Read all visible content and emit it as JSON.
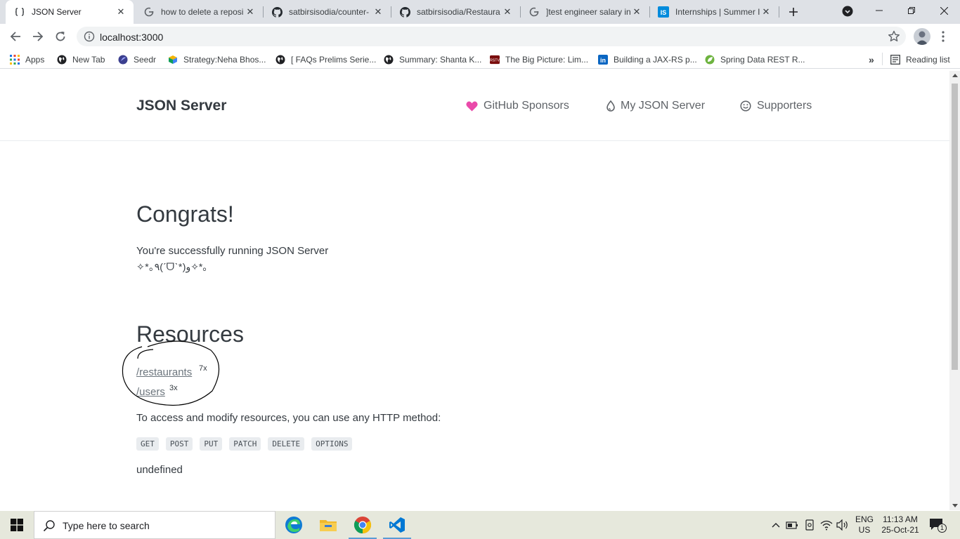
{
  "browser": {
    "tabs": [
      {
        "title": "JSON Server",
        "active": true
      },
      {
        "title": "how to delete a reposi",
        "active": false
      },
      {
        "title": "satbirsisodia/counter-",
        "active": false
      },
      {
        "title": "satbirsisodia/Restaura",
        "active": false
      },
      {
        "title": "]test engineer salary in",
        "active": false
      },
      {
        "title": "Internships | Summer I",
        "active": false
      }
    ],
    "url": "localhost:3000",
    "bookmarks": [
      {
        "label": "Apps",
        "icon": "apps-grid-icon"
      },
      {
        "label": "New Tab",
        "icon": "globe-icon"
      },
      {
        "label": "Seedr",
        "icon": "seedr-icon"
      },
      {
        "label": "Strategy:Neha Bhos...",
        "icon": "cube-icon"
      },
      {
        "label": "[ FAQs Prelims Serie...",
        "icon": "globe-icon"
      },
      {
        "label": "Summary: Shanta K...",
        "icon": "globe-icon"
      },
      {
        "label": "The Big Picture: Lim...",
        "icon": "rstv-icon"
      },
      {
        "label": "Building a JAX-RS p...",
        "icon": "linkedin-icon"
      },
      {
        "label": "Spring Data REST R...",
        "icon": "spring-leaf-icon"
      }
    ],
    "reading_list": "Reading list",
    "overflow": "»"
  },
  "site": {
    "brand": "JSON Server",
    "nav": [
      {
        "label": "GitHub Sponsors",
        "icon": "heart-icon"
      },
      {
        "label": "My JSON Server",
        "icon": "drop-icon"
      },
      {
        "label": "Supporters",
        "icon": "smile-icon"
      }
    ]
  },
  "content": {
    "heading": "Congrats!",
    "running": "You're successfully running JSON Server",
    "kaomoji": "✧*｡٩(ˊᗜˋ*)و✧*｡",
    "resources_heading": "Resources",
    "resources": [
      {
        "path": "/restaurants",
        "count": "7x"
      },
      {
        "path": "/users",
        "count": "3x"
      }
    ],
    "access_text": "To access and modify resources, you can use any HTTP method:",
    "methods": [
      "GET",
      "POST",
      "PUT",
      "PATCH",
      "DELETE",
      "OPTIONS"
    ],
    "footer_text": "undefined"
  },
  "taskbar": {
    "search_placeholder": "Type here to search",
    "lang_line1": "ENG",
    "lang_line2": "US",
    "time": "11:13 AM",
    "date": "25-Oct-21",
    "notification_count": "1"
  },
  "colors": {
    "tabstrip": "#dee1e6",
    "heart": "#ea4aaa",
    "link": "#6c757d",
    "taskbar": "#e6e8dc"
  }
}
